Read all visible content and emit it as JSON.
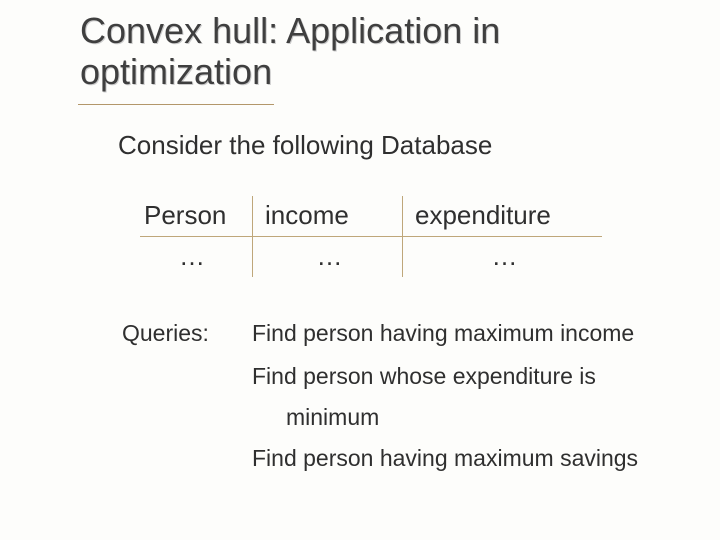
{
  "title": "Convex hull: Application in optimization",
  "subtitle": "Consider the following Database",
  "table": {
    "headers": {
      "c1": "Person",
      "c2": "income",
      "c3": "expenditure"
    },
    "row": {
      "c1": "…",
      "c2": "…",
      "c3": "…"
    }
  },
  "queries": {
    "label": "Queries:",
    "q1": "Find person having maximum income",
    "q2a": "Find person whose expenditure is",
    "q2b": "minimum",
    "q3": "Find person having maximum savings"
  }
}
